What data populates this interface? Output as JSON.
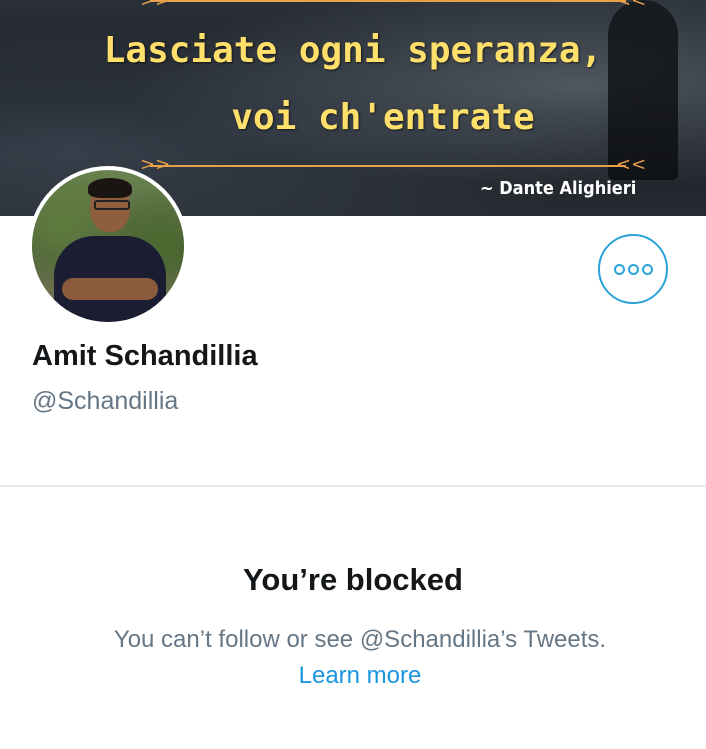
{
  "banner": {
    "quote_line1": "Lasciate ogni speranza,",
    "quote_line2": "voi ch'entrate",
    "author": "~ Dante Alighieri"
  },
  "profile": {
    "display_name": "Amit Schandillia",
    "handle": "@Schandillia",
    "more_icon": "more-options-icon"
  },
  "blocked": {
    "title": "You’re blocked",
    "message": "You can’t follow or see @Schandillia’s Tweets.",
    "learn_more": "Learn more"
  },
  "colors": {
    "accent": "#1b95e0",
    "quote": "#ffe06a",
    "ornament": "#e8a04a",
    "muted_text": "#657786"
  }
}
